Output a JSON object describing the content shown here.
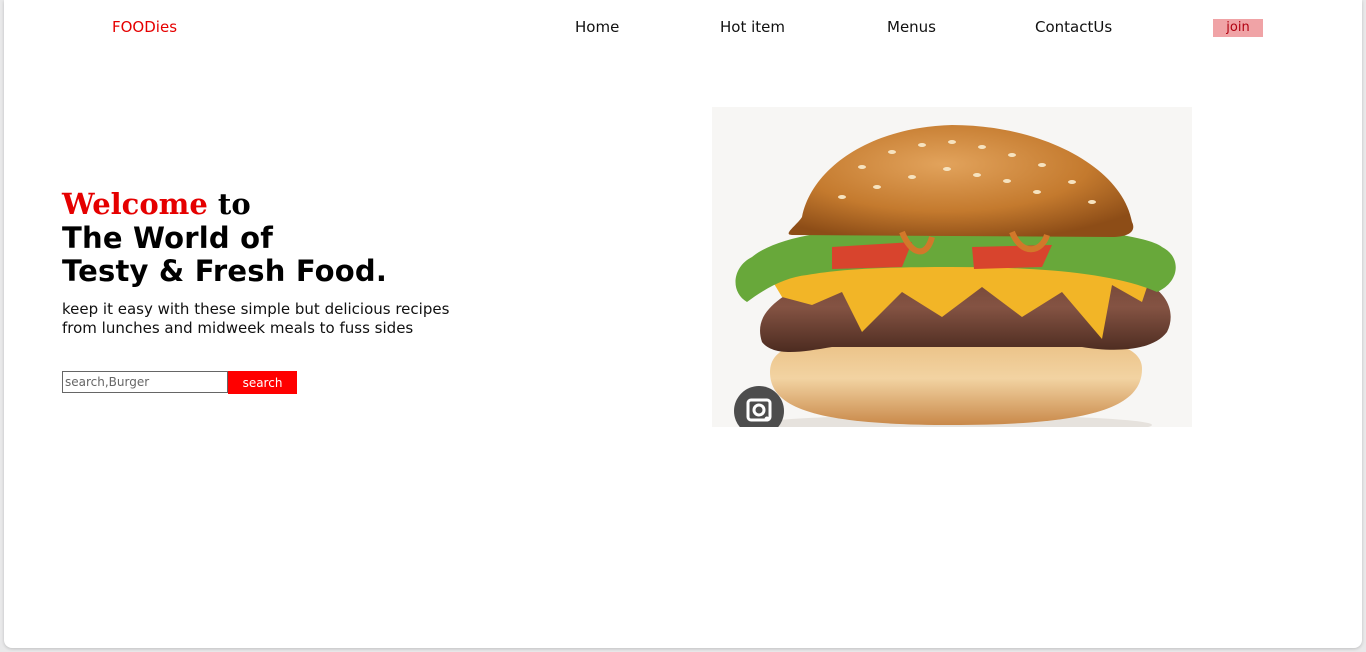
{
  "header": {
    "brand": "FOODies",
    "nav": [
      "Home",
      "Hot item",
      "Menus",
      "ContactUs"
    ],
    "join_label": "join"
  },
  "hero": {
    "welcome_word": "Welcome",
    "welcome_to": "to",
    "headline_line1": "The World of",
    "headline_line2": "Testy & Fresh Food.",
    "description_line1": "keep it easy with these simple but delicious recipes",
    "description_line2": "from lunches and midweek meals to fuss sides"
  },
  "search": {
    "placeholder": "search,Burger",
    "button_label": "search"
  },
  "image": {
    "icon": "lens-icon"
  },
  "colors": {
    "accent": "#e50000",
    "button": "#ff0000",
    "join_bg": "#f0a3a6"
  }
}
